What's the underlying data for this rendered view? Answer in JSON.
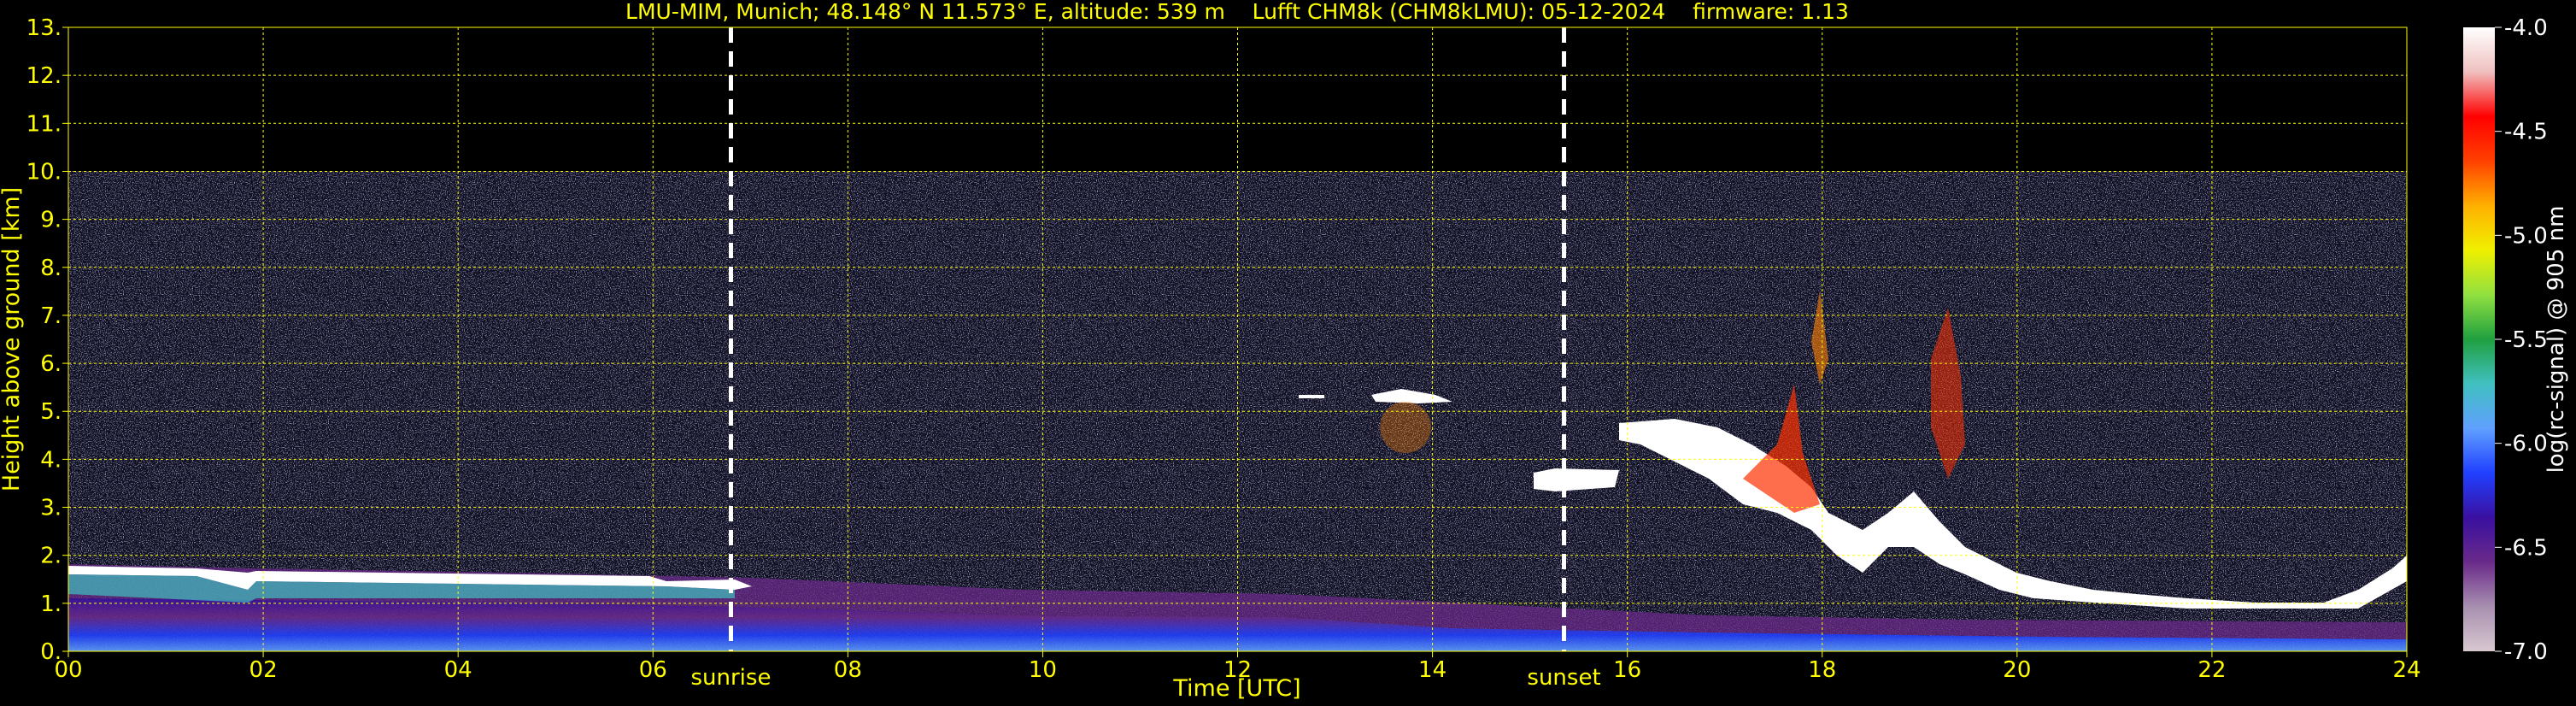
{
  "chart_data": {
    "type": "heatmap",
    "title": "LMU-MIM, Munich; 48.148° N 11.573° E, altitude: 539 m    Lufft CHM8k (CHM8kLMU): 05-12-2024    firmware: 1.13",
    "xlabel": "Time [UTC]",
    "ylabel": "Height above ground [km]",
    "xlim": [
      0,
      24
    ],
    "ylim": [
      0,
      13
    ],
    "x_ticks": [
      "00",
      "02",
      "04",
      "06",
      "08",
      "10",
      "12",
      "14",
      "16",
      "18",
      "20",
      "22",
      "24"
    ],
    "y_ticks": [
      "0.",
      "1.",
      "2.",
      "3.",
      "4.",
      "5.",
      "6.",
      "7.",
      "8.",
      "9.",
      "10.",
      "11.",
      "12.",
      "13."
    ],
    "grid": true,
    "annotations": [
      {
        "label": "sunrise",
        "x": 6.8
      },
      {
        "label": "sunset",
        "x": 15.35
      }
    ],
    "colorbar": {
      "label": "log(rc-signal) @ 905 nm",
      "ticks": [
        "-4.0",
        "-4.5",
        "-5.0",
        "-5.5",
        "-6.0",
        "-6.5",
        "-7.0"
      ],
      "range": [
        -7.0,
        -4.0
      ]
    },
    "features": [
      {
        "name": "low cloud deck",
        "x": [
          0,
          6.9
        ],
        "height_km": [
          1.5,
          1.75
        ]
      },
      {
        "name": "mid cloud",
        "x": [
          13.4,
          14.2
        ],
        "height_km": [
          5.0,
          5.2
        ]
      },
      {
        "name": "evening cloud layer",
        "x": [
          15.3,
          24
        ],
        "height_km": [
          1.0,
          4.6
        ]
      },
      {
        "name": "boundary layer",
        "x": [
          0,
          24
        ],
        "height_km": [
          0,
          1.2
        ]
      }
    ],
    "data_range_top_km": 10
  },
  "colors": {
    "text": "#ffff00",
    "grid": "#ffff00",
    "background": "#000000",
    "colorbar_stops": [
      "#d8c8d0",
      "#a890b0",
      "#6a2a8a",
      "#3a10a0",
      "#2040ff",
      "#60a0ff",
      "#40c0c0",
      "#20a040",
      "#90e040",
      "#f0f000",
      "#ffb000",
      "#ff4000",
      "#ff0000",
      "#f0c0c0",
      "#ffffff"
    ]
  }
}
